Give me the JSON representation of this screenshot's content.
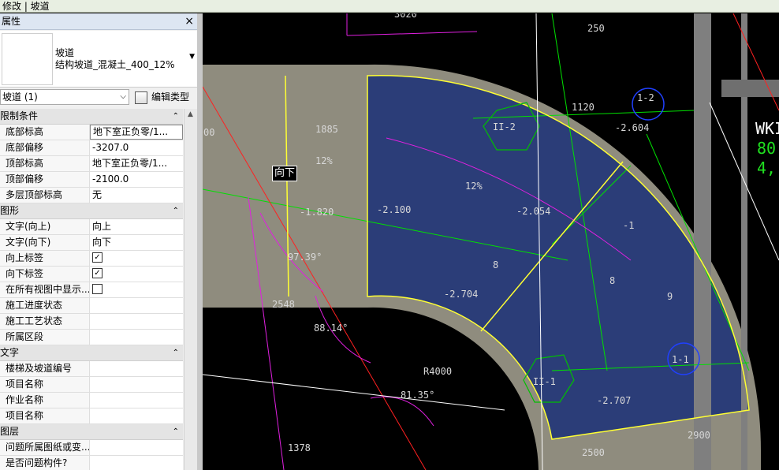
{
  "ribbon": {
    "context": "修改 | 坡道"
  },
  "panel": {
    "title": "属性",
    "close": "×",
    "type_family": "坡道",
    "type_name": "结构坡道_混凝土_400_12%",
    "instance_selector": "坡道 (1)",
    "edit_type": "编辑类型",
    "categories": [
      {
        "label": "限制条件",
        "rows": [
          {
            "name": "底部标高",
            "value": "地下室正负零/1..."
          },
          {
            "name": "底部偏移",
            "value": "-3207.0"
          },
          {
            "name": "顶部标高",
            "value": "地下室正负零/1..."
          },
          {
            "name": "顶部偏移",
            "value": "-2100.0"
          },
          {
            "name": "多层顶部标高",
            "value": "无"
          }
        ]
      },
      {
        "label": "图形",
        "rows": [
          {
            "name": "文字(向上)",
            "value": "向上"
          },
          {
            "name": "文字(向下)",
            "value": "向下"
          },
          {
            "name": "向上标签",
            "value": "",
            "check": true
          },
          {
            "name": "向下标签",
            "value": "",
            "check": true
          },
          {
            "name": "在所有视图中显示...",
            "value": "",
            "check": false
          },
          {
            "name": "施工进度状态",
            "value": ""
          },
          {
            "name": "施工工艺状态",
            "value": ""
          },
          {
            "name": "所属区段",
            "value": ""
          }
        ]
      },
      {
        "label": "文字",
        "rows": [
          {
            "name": "楼梯及坡道编号",
            "value": ""
          },
          {
            "name": "项目名称",
            "value": ""
          },
          {
            "name": "作业名称",
            "value": ""
          },
          {
            "name": "项目名称",
            "value": ""
          }
        ]
      },
      {
        "label": "图层",
        "rows": [
          {
            "name": "问题所属图纸或变...",
            "value": ""
          },
          {
            "name": "是否问题构件?",
            "value": ""
          }
        ]
      }
    ]
  },
  "canvas": {
    "ramp_label": "向下",
    "labels": [
      "3020",
      "00",
      "1885",
      "250",
      "1120",
      "WKI",
      "80",
      "4,,",
      "-2.604",
      "-2.100",
      "-1.820",
      "-2.054",
      "-2.704",
      "-2.707",
      "12%",
      "12%",
      "97.39°",
      "88.14°",
      "81.35°",
      "2548",
      "1378",
      "R4000",
      "2900",
      "2500",
      "8",
      "8",
      "-1",
      "9",
      "II-2",
      "II-1",
      "1-2",
      "1-1"
    ]
  },
  "colors": {
    "ramp_fill": "#2b3d78",
    "concrete": "#7f7f7f",
    "ring": "#8f8c7e",
    "selection": "#ffff33"
  }
}
